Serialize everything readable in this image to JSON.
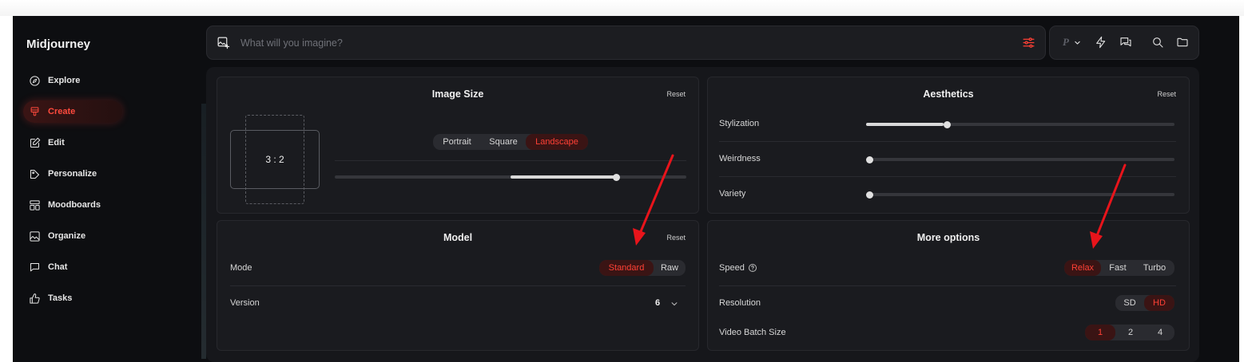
{
  "app": {
    "title": "Midjourney"
  },
  "sidebar": {
    "items": [
      {
        "label": "Explore",
        "icon": "compass-icon"
      },
      {
        "label": "Create",
        "icon": "paintbrush-icon",
        "active": true
      },
      {
        "label": "Edit",
        "icon": "edit-icon"
      },
      {
        "label": "Personalize",
        "icon": "personalize-icon"
      },
      {
        "label": "Moodboards",
        "icon": "moodboard-icon"
      },
      {
        "label": "Organize",
        "icon": "image-icon"
      },
      {
        "label": "Chat",
        "icon": "chat-icon"
      },
      {
        "label": "Tasks",
        "icon": "thumbs-up-icon"
      }
    ]
  },
  "prompt": {
    "placeholder": "What will you imagine?"
  },
  "toolbar": {
    "profile_letter": "P"
  },
  "image_size": {
    "title": "Image Size",
    "reset": "Reset",
    "ratio": "3 : 2",
    "orientations": [
      "Portrait",
      "Square",
      "Landscape"
    ],
    "selected": "Landscape",
    "slider_value": 0.8
  },
  "aesthetics": {
    "title": "Aesthetics",
    "reset": "Reset",
    "sliders": [
      {
        "label": "Stylization",
        "value": 0.25
      },
      {
        "label": "Weirdness",
        "value": 0.0
      },
      {
        "label": "Variety",
        "value": 0.0
      }
    ]
  },
  "model": {
    "title": "Model",
    "reset": "Reset",
    "mode_label": "Mode",
    "modes": [
      "Standard",
      "Raw"
    ],
    "mode_selected": "Standard",
    "version_label": "Version",
    "version_value": "6"
  },
  "more_options": {
    "title": "More options",
    "speed_label": "Speed",
    "speeds": [
      "Relax",
      "Fast",
      "Turbo"
    ],
    "speed_selected": "Relax",
    "resolution_label": "Resolution",
    "resolutions": [
      "SD",
      "HD"
    ],
    "resolution_selected": "HD",
    "batch_label": "Video Batch Size",
    "batches": [
      "1",
      "2",
      "4"
    ],
    "batch_selected": "1"
  },
  "colors": {
    "accent": "#ff4035",
    "background": "#0d0e11",
    "card": "#1a1b1f",
    "annotation_arrow": "#e8141b"
  }
}
